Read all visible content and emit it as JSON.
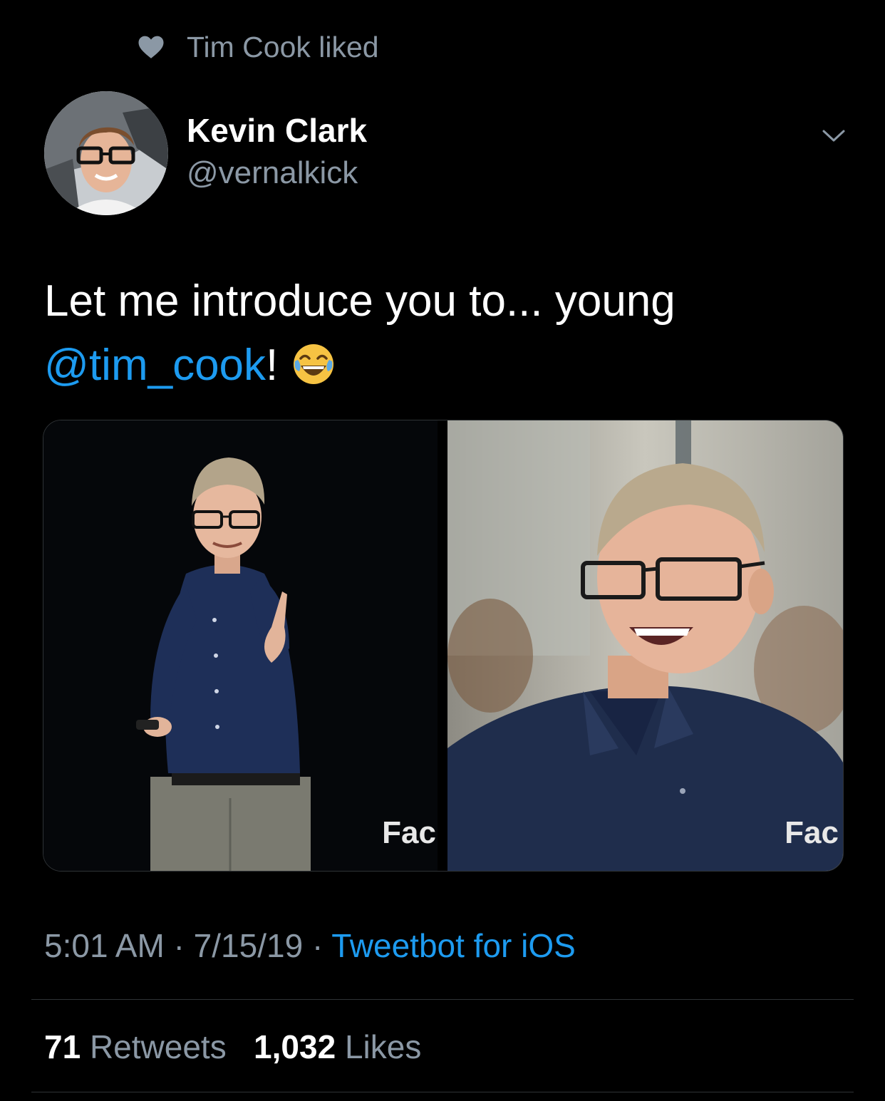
{
  "social_context": {
    "text": "Tim Cook liked",
    "icon": "heart-icon"
  },
  "author": {
    "display_name": "Kevin Clark",
    "handle": "@vernalkick"
  },
  "tweet": {
    "text_before": "Let me introduce you to... young",
    "mention": "@tim_cook",
    "text_after": "!",
    "emoji": "face-with-tears-of-joy"
  },
  "media": {
    "images": [
      {
        "description": "stage-presenter-photo",
        "watermark": "Fac"
      },
      {
        "description": "laughing-portrait-photo",
        "watermark": "Fac"
      }
    ]
  },
  "meta": {
    "time": "5:01 AM",
    "separator": "·",
    "date": "7/15/19",
    "source": "Tweetbot for iOS"
  },
  "stats": {
    "retweets_count": "71",
    "retweets_label": "Retweets",
    "likes_count": "1,032",
    "likes_label": "Likes"
  },
  "colors": {
    "background": "#000000",
    "accent": "#1d9bf0",
    "secondary_text": "#8b98a5",
    "divider": "#2f3336"
  }
}
